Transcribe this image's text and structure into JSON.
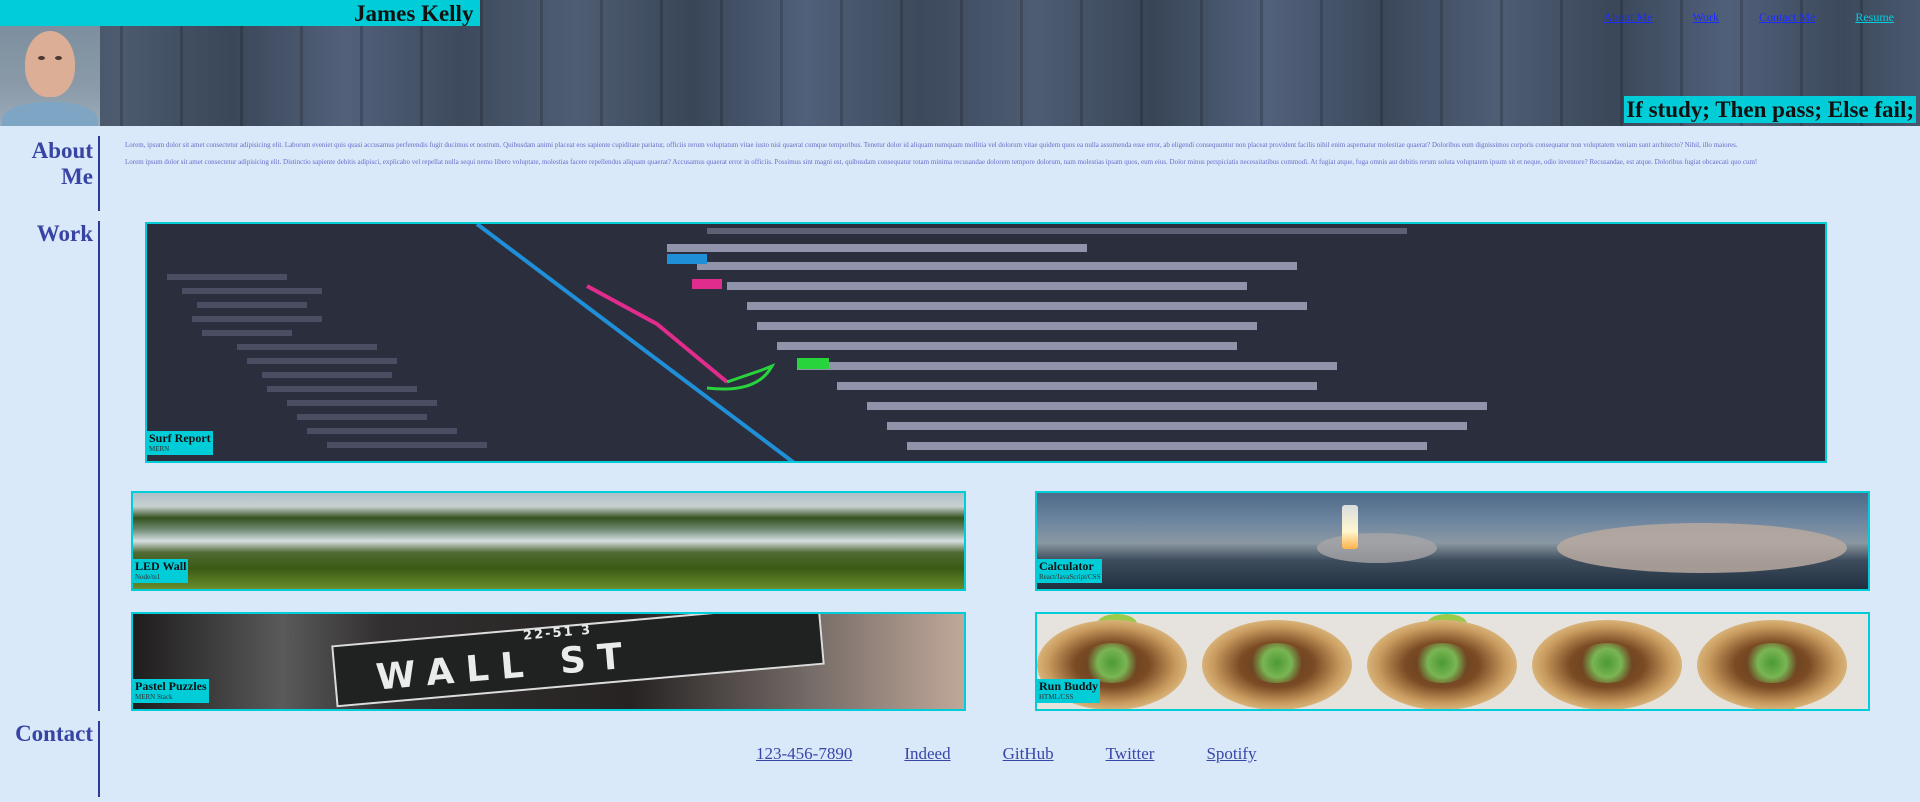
{
  "header": {
    "name": "James Kelly",
    "tagline": "If study; Then pass; Else fail;",
    "nav": [
      {
        "label": "About Me"
      },
      {
        "label": "Work"
      },
      {
        "label": "Contact Me"
      },
      {
        "label": "Resume"
      }
    ]
  },
  "about": {
    "heading_line1": "About",
    "heading_line2": "Me",
    "paragraph1": "Lorem, ipsum dolor sit amet consectetur adipisicing elit. Laborum eveniet quis quasi accusamus perferendis fugit ducimus et nostrum. Quibusdam animi placeat eos sapiente cupiditate pariatur, officiis rerum voluptatum vitae iusto nisi quaerat cumque temporibus. Tenetur dolor id aliquam numquam mollitia vel dolorum vitae quidem quos ea nulla assumenda esse error, ab eligendi consequuntur non placeat provident facilis nihil enim aspernatur molestiae quaerat? Doloribus eum dignissimos corporis consequatur non voluptatem veniam sunt architecto? Nihil, illo maiores.",
    "paragraph2": "Lorem ipsum dolor sit amet consectetur adipisicing elit. Distinctio sapiente debitis adipisci, explicabo vel repellat nulla sequi nemo libero voluptate, molestias facere repellendus aliquam quaerat? Accusamus quaerat error in officiis. Possimus sint magni est, quibusdam consequatur totam minima recusandae dolorem tempore dolorum, nam molestias ipsam quos, eum eius. Dolor minus perspiciatis necessitatibus commodi. At fugiat atque, fuga omnis aut debitis rerum soluta voluptatem ipsum sit et neque, odio inventore? Recusandae, est atque. Doloribus fugiat obcaecati quo cum!"
  },
  "work": {
    "heading": "Work",
    "projects": [
      {
        "title": "Surf Report",
        "tech": "MERN"
      },
      {
        "title": "LED Wall",
        "tech": "Node/ts1"
      },
      {
        "title": "Calculator",
        "tech": "React/JavaScript/CSS"
      },
      {
        "title": "Pastel Puzzles",
        "tech": "MERN Stack"
      },
      {
        "title": "Run Buddy",
        "tech": "HTML/CSS"
      }
    ],
    "wall_sign": {
      "street": "WALL ST",
      "number": "22-51 3"
    }
  },
  "contact": {
    "heading": "Contact",
    "links": [
      {
        "label": "123-456-7890"
      },
      {
        "label": "Indeed"
      },
      {
        "label": "GitHub"
      },
      {
        "label": "Twitter"
      },
      {
        "label": "Spotify"
      }
    ]
  },
  "colors": {
    "background": "#d9e9fa",
    "accent": "#00cdd8",
    "heading": "#3744a3",
    "link": "#1a2cff"
  }
}
